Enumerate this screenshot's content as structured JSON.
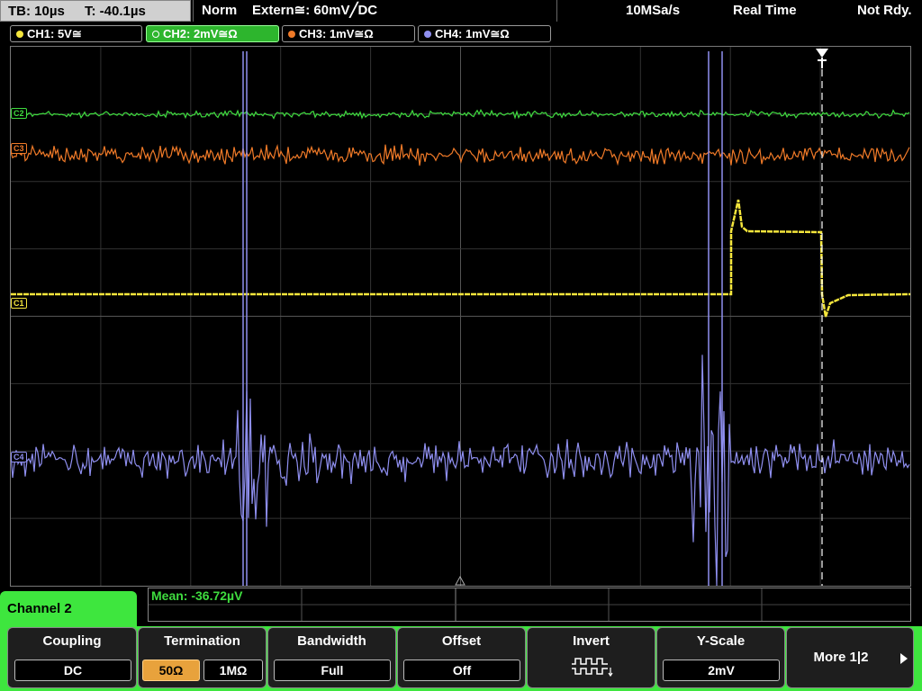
{
  "status": {
    "timebase": "TB: 10µs",
    "trigger_time": "T: -40.1µs",
    "mode": "Norm",
    "trigger_source": "Extern≅: 60mV╱DC",
    "sample_rate": "10MSa/s",
    "acq_mode": "Real Time",
    "ready_state": "Not Rdy."
  },
  "channels": [
    {
      "label": "CH1: 5V≅",
      "color": "#f5e63c",
      "active": false
    },
    {
      "label": "CH2: 2mV≅Ω",
      "color": "#3fdc3f",
      "active": true
    },
    {
      "label": "CH3: 1mV≅Ω",
      "color": "#f07a28",
      "active": false
    },
    {
      "label": "CH4: 1mV≅Ω",
      "color": "#8f8ff0",
      "active": false
    }
  ],
  "markers": {
    "ch2": "C2",
    "ch3": "C3",
    "ch1": "C1",
    "ch4": "C4"
  },
  "measurement": {
    "mean": "Mean: -36.72µV"
  },
  "menu": {
    "title": "Channel 2",
    "coupling": {
      "label": "Coupling",
      "value": "DC"
    },
    "termination": {
      "label": "Termination",
      "options": [
        "50Ω",
        "1MΩ"
      ],
      "selected": "50Ω"
    },
    "bandwidth": {
      "label": "Bandwidth",
      "value": "Full"
    },
    "offset": {
      "label": "Offset",
      "value": "Off"
    },
    "invert": {
      "label": "Invert"
    },
    "yscale": {
      "label": "Y-Scale",
      "value": "2mV"
    },
    "more": {
      "label": "More 1|2"
    }
  },
  "colors": {
    "ch1": "#f5e63c",
    "ch2": "#3fdc3f",
    "ch3": "#f07a28",
    "ch4": "#8f8ff0",
    "menu_accent": "#3ee63e",
    "selected_option": "#e8a23c"
  }
}
